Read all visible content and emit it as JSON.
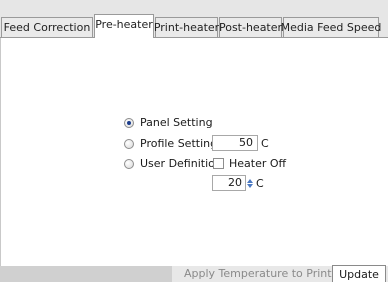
{
  "tabs": [
    {
      "label": "Feed Correction",
      "active": false
    },
    {
      "label": "Pre-heater",
      "active": true
    },
    {
      "label": "Print-heater",
      "active": false
    },
    {
      "label": "Post-heater",
      "active": false
    },
    {
      "label": "Media Feed Speed",
      "active": false
    }
  ],
  "options": {
    "panel_setting": {
      "label": "Panel Setting",
      "selected": true
    },
    "profile_setting": {
      "label": "Profile Setting",
      "selected": false,
      "value": "50",
      "unit": "C"
    },
    "user_definition": {
      "label": "User Definition",
      "selected": false
    },
    "heater_off": {
      "label": "Heater Off",
      "checked": false
    },
    "temperature": {
      "value": "20",
      "unit": "C"
    }
  },
  "footer": {
    "apply_label": "Apply Temperature to Printer",
    "update_label": "Update"
  },
  "colors": {
    "radio_dot": "#1c3d8c",
    "spinner_arrow": "#4a78c2"
  },
  "icons": {
    "spinner": "spinner-arrows-icon"
  }
}
